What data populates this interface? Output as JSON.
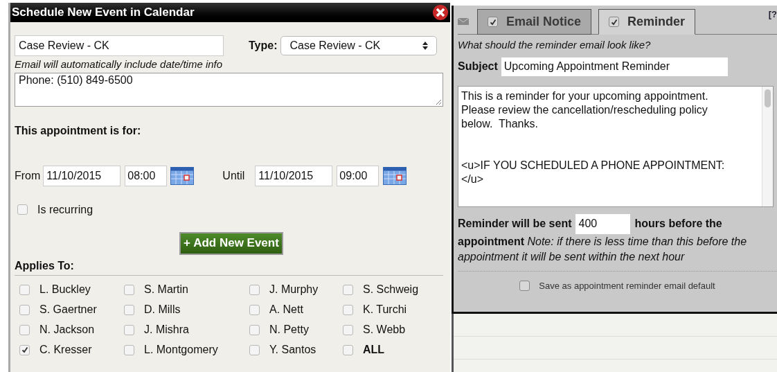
{
  "dialog": {
    "title": "Schedule New Event in Calendar",
    "event_name": "Case Review - CK",
    "type_label": "Type:",
    "type_value": "Case Review - CK",
    "email_hint": "Email will automatically include date/time info",
    "details": "Phone: (510) 849-6500",
    "for_label": "This appointment is for:",
    "from_label": "From",
    "from_date": "11/10/2015",
    "from_time": "08:00",
    "until_label": "Until",
    "until_date": "11/10/2015",
    "until_time": "09:00",
    "recurring": {
      "label": "Is recurring",
      "checked": false
    },
    "add_button": "+ Add New Event",
    "applies_label": "Applies To:",
    "people": [
      {
        "label": "L. Buckley",
        "checked": false
      },
      {
        "label": "S. Martin",
        "checked": false
      },
      {
        "label": "J. Murphy",
        "checked": false
      },
      {
        "label": "S. Schweig",
        "checked": false
      },
      {
        "label": "S. Gaertner",
        "checked": false
      },
      {
        "label": "D. Mills",
        "checked": false
      },
      {
        "label": "A. Nett",
        "checked": false
      },
      {
        "label": "K. Turchi",
        "checked": false
      },
      {
        "label": "N. Jackson",
        "checked": false
      },
      {
        "label": "J. Mishra",
        "checked": false
      },
      {
        "label": "N. Petty",
        "checked": false
      },
      {
        "label": "S. Webb",
        "checked": false
      },
      {
        "label": "C. Kresser",
        "checked": true
      },
      {
        "label": "L. Montgomery",
        "checked": false
      },
      {
        "label": "Y. Santos",
        "checked": false
      },
      {
        "label": "ALL",
        "checked": false,
        "kind": "all"
      }
    ]
  },
  "reminder_panel": {
    "help": "[?",
    "tabs": [
      {
        "label": "Email Notice",
        "checked": true,
        "selected": false
      },
      {
        "label": "Reminder",
        "checked": true,
        "selected": true
      }
    ],
    "question": "What should the reminder email look like?",
    "subject_label": "Subject",
    "subject": "Upcoming Appointment Reminder",
    "body_paragraphs": [
      [
        "This is a reminder for your upcoming appointment.",
        "Please review the cancellation/rescheduling policy",
        "below.  Thanks."
      ],
      [
        "<u>IF YOU SCHEDULED A PHONE APPOINTMENT:",
        "</u>"
      ]
    ],
    "hours_prefix": "Reminder will be sent",
    "hours": "400",
    "hours_suffix": "hours before the",
    "appointment_word": "appointment",
    "note": "Note: if there is less time than this before the appointment it will be sent within the next hour",
    "save_default": {
      "label": "Save as appointment reminder email default",
      "checked": false
    }
  }
}
